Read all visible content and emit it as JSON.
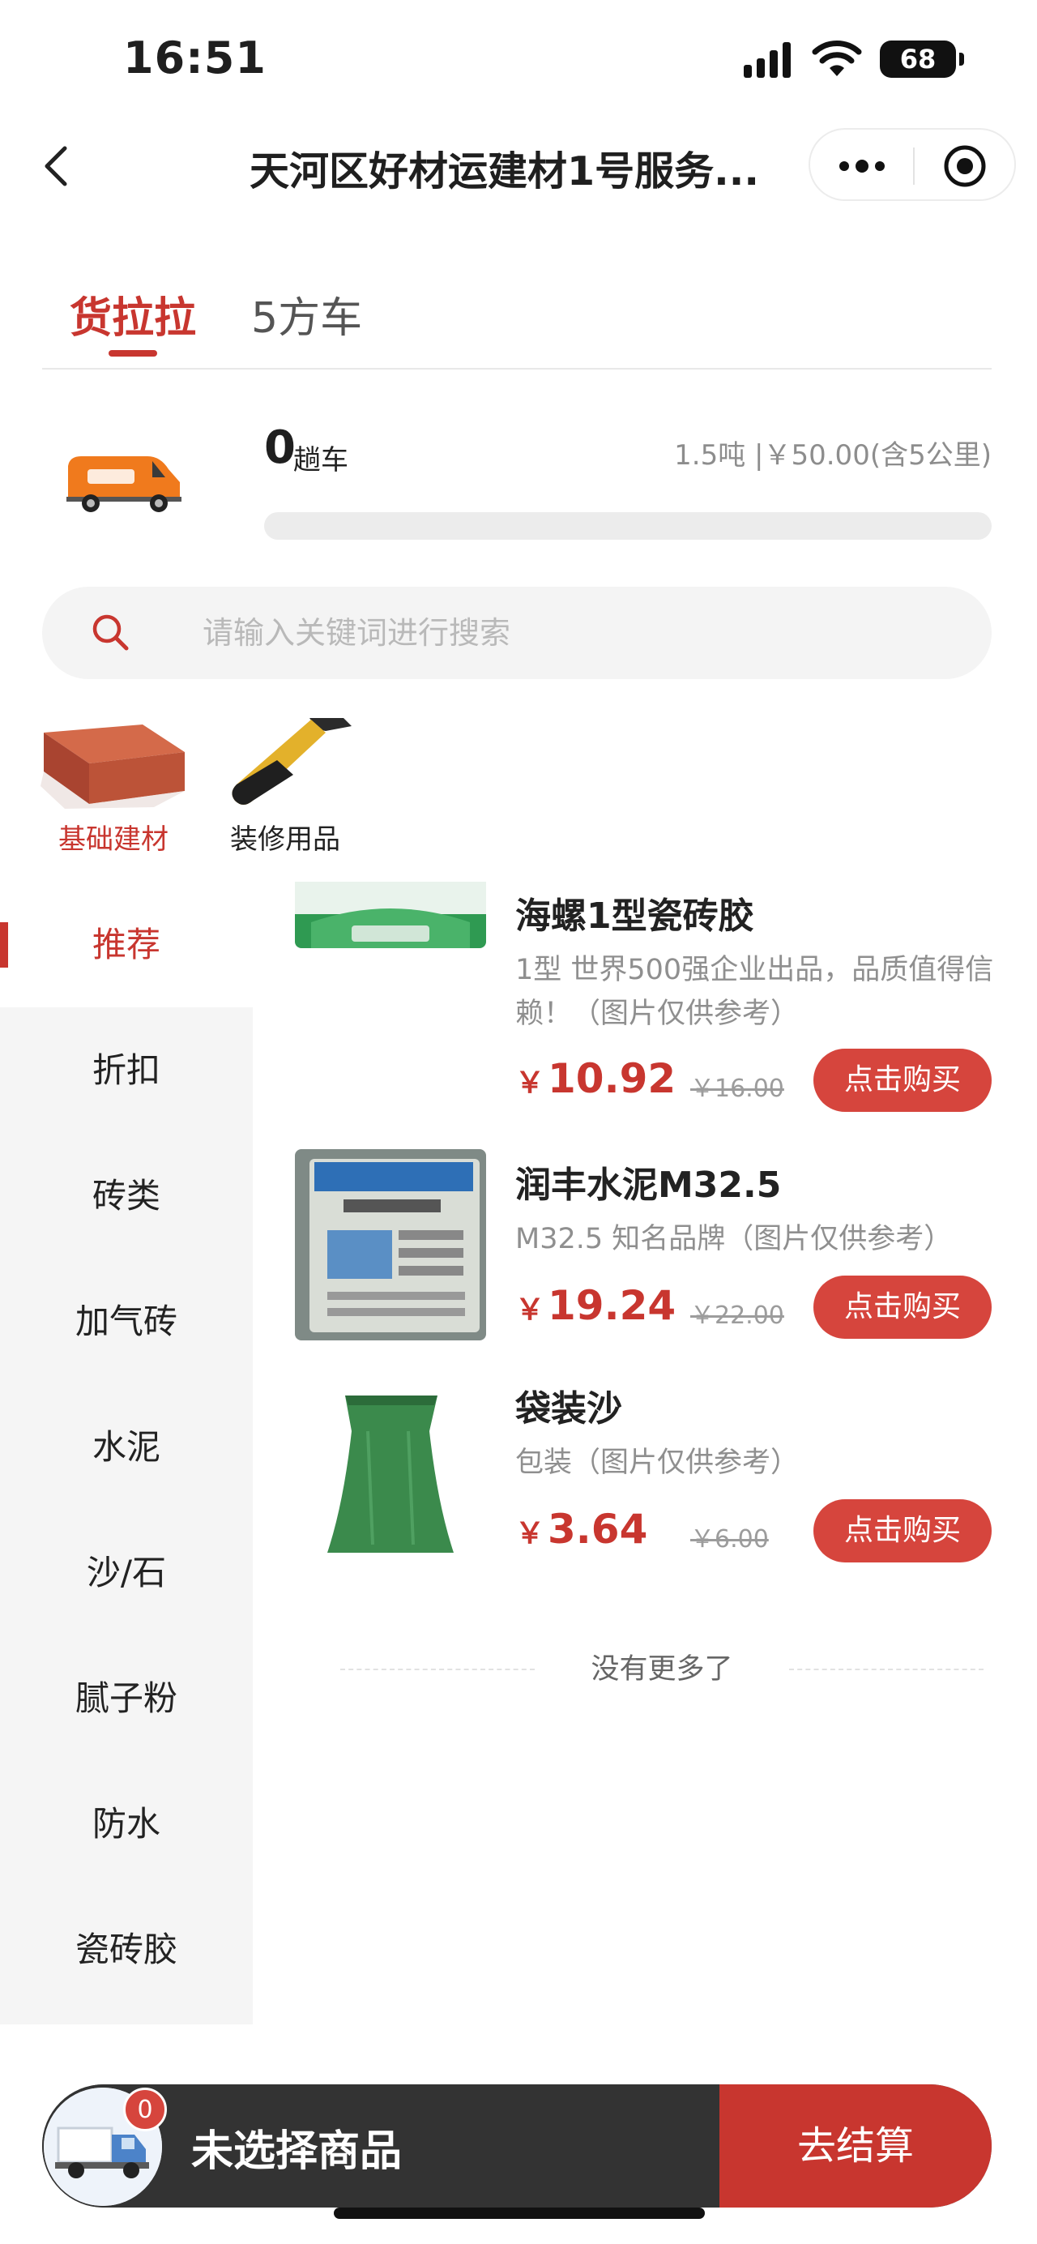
{
  "status_bar": {
    "time": "16:51",
    "battery": "68"
  },
  "nav": {
    "title": "天河区好材运建材1号服务..."
  },
  "tabs": [
    {
      "label": "货拉拉"
    },
    {
      "label": "5方车"
    }
  ],
  "trip": {
    "count": "0",
    "unit": "趟车",
    "price_info": "1.5吨 |￥50.00(含5公里)",
    "progress": 0
  },
  "search": {
    "placeholder": "请输入关键词进行搜索"
  },
  "categories": [
    {
      "label": "基础建材"
    },
    {
      "label": "装修用品"
    }
  ],
  "side_nav": [
    {
      "label": "推荐"
    },
    {
      "label": "折扣"
    },
    {
      "label": "砖类"
    },
    {
      "label": "加气砖"
    },
    {
      "label": "水泥"
    },
    {
      "label": "沙/石"
    },
    {
      "label": "腻子粉"
    },
    {
      "label": "防水"
    },
    {
      "label": "瓷砖胶"
    }
  ],
  "products": [
    {
      "name": "海螺1型瓷砖胶",
      "desc": "1型 世界500强企业出品，品质值得信赖！（图片仅供参考）",
      "currency": "￥",
      "price": "10.92",
      "old_price": "￥16.00",
      "button": "点击购买"
    },
    {
      "name": "润丰水泥M32.5",
      "desc": "M32.5 知名品牌（图片仅供参考）",
      "currency": "￥",
      "price": "19.24",
      "old_price": "￥22.00",
      "button": "点击购买"
    },
    {
      "name": "袋装沙",
      "desc": "包装（图片仅供参考）",
      "currency": "￥",
      "price": "3.64",
      "old_price": "￥6.00",
      "button": "点击购买"
    }
  ],
  "end_text": "没有更多了",
  "cart": {
    "badge": "0",
    "status": "未选择商品",
    "checkout": "去结算"
  },
  "colors": {
    "accent": "#c8362f",
    "button": "#d6453d",
    "bar_dark": "#333333"
  }
}
